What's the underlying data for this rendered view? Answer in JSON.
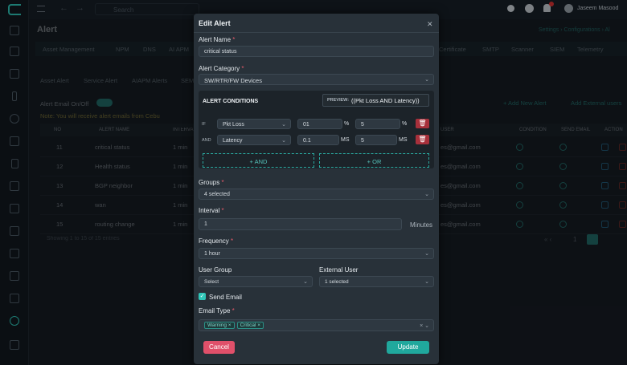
{
  "topbar": {
    "search_placeholder": "Search",
    "user_name": "Jaseem Masood"
  },
  "page": {
    "title": "Alert",
    "breadcrumb": "Settings › Configurations › Al"
  },
  "tabs": [
    "Asset Management",
    "NPM",
    "DNS",
    "AI APM",
    "Certificate",
    "SMTP",
    "Scanner",
    "SIEM",
    "Telemetry"
  ],
  "subtabs": [
    "Asset Alert",
    "Service Alert",
    "AIAPM Alerts",
    "SEM"
  ],
  "alert_email_label": "Alert Email On/Off",
  "note": "Note: You will receive alert emails from Cebu",
  "buttons_bg": {
    "add_alert": "+ Add New Alert",
    "add_external": "Add External users"
  },
  "table": {
    "headers": [
      "NO",
      "ALERT NAME",
      "INTERVAL",
      "USER",
      "CONDITION",
      "SEND EMAIL",
      "ACTION"
    ],
    "rows": [
      {
        "no": "11",
        "name": "critical status",
        "interval": "1 min",
        "user": "es@gmail.com"
      },
      {
        "no": "12",
        "name": "Health status",
        "interval": "1 min",
        "user": "es@gmail.com"
      },
      {
        "no": "13",
        "name": "BGP neighbor",
        "interval": "1 min",
        "user": "es@gmail.com"
      },
      {
        "no": "14",
        "name": "wan",
        "interval": "1 min",
        "user": "es@gmail.com"
      },
      {
        "no": "15",
        "name": "routing change",
        "interval": "1 min",
        "user": "es@gmail.com"
      }
    ],
    "footer": "Showing 1 to 15 of 15 entries",
    "page_number": "1"
  },
  "modal": {
    "title": "Edit Alert",
    "alert_name_label": "Alert Name",
    "alert_name_value": "critical status",
    "alert_category_label": "Alert Category",
    "alert_category_value": "SW/RTR/FW Devices",
    "conditions_title": "ALERT CONDITIONS",
    "preview_label": "PREVIEW:",
    "preview_value": "((Pkt Loss AND Latency))",
    "conditions": [
      {
        "op": "IF",
        "metric": "Pkt Loss",
        "v1": "01",
        "u1": "%",
        "v2": "5",
        "u2": "%"
      },
      {
        "op": "AND",
        "metric": "Latency",
        "v1": "0.1",
        "u1": "MS",
        "v2": "5",
        "u2": "MS"
      }
    ],
    "and_btn": "+ AND",
    "or_btn": "+ OR",
    "groups_label": "Groups",
    "groups_value": "4 selected",
    "interval_label": "Interval",
    "interval_value": "1",
    "interval_unit": "Minutes",
    "frequency_label": "Frequency",
    "frequency_value": "1 hour",
    "user_group_label": "User Group",
    "user_group_value": "Select",
    "external_user_label": "External User",
    "external_user_value": "1 selected",
    "send_email_label": "Send Email",
    "email_type_label": "Email Type",
    "email_types": [
      "Warning",
      "Critical"
    ],
    "cancel": "Cancel",
    "update": "Update"
  }
}
